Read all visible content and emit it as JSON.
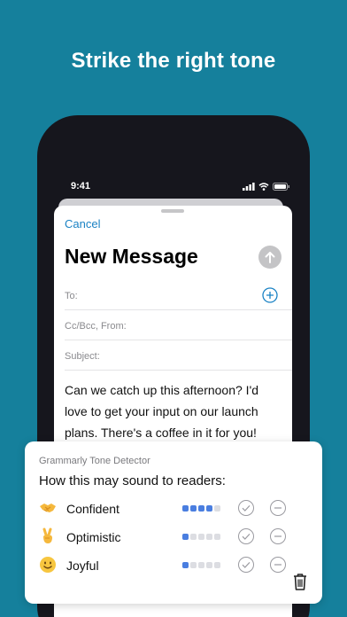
{
  "headline": "Strike the right tone",
  "status_bar": {
    "time": "9:41"
  },
  "compose": {
    "cancel_label": "Cancel",
    "title": "New Message",
    "to_label": "To:",
    "ccbcc_label": "Cc/Bcc, From:",
    "subject_label": "Subject:",
    "body": "Can we catch up this afternoon? I'd love to get your input on our launch plans. There's a coffee in it for you!"
  },
  "tone_detector": {
    "title": "Grammarly Tone Detector",
    "subtitle": "How this may sound to readers:",
    "tones": [
      {
        "label": "Confident",
        "emoji": "handshake-emoji",
        "level": 4,
        "max": 5
      },
      {
        "label": "Optimistic",
        "emoji": "victory-hand-emoji",
        "level": 1,
        "max": 5
      },
      {
        "label": "Joyful",
        "emoji": "smiling-face-emoji",
        "level": 1,
        "max": 5
      }
    ]
  },
  "colors": {
    "background": "#15809c",
    "accent": "#1a82c4",
    "dot_on": "#4a7ee0",
    "dot_off": "#dcdde2"
  }
}
